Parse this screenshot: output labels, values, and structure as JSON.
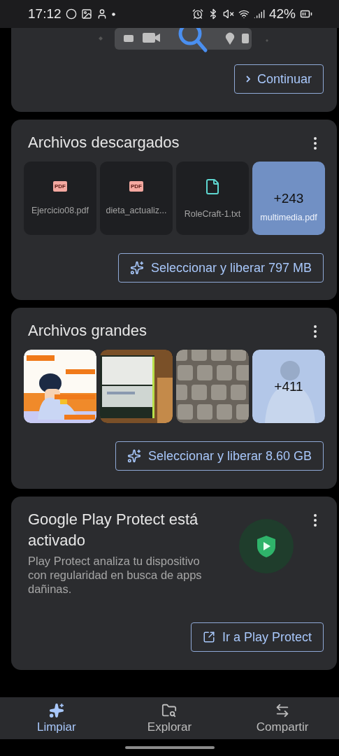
{
  "status_bar": {
    "time": "17:12",
    "battery": "42%"
  },
  "banner": {
    "button": "Continuar"
  },
  "downloads": {
    "title": "Archivos descargados",
    "files": [
      {
        "kind": "pdf",
        "badge": "PDF",
        "name": "Ejercicio08.pdf"
      },
      {
        "kind": "pdf",
        "badge": "PDF",
        "name": "dieta_actualiz..."
      },
      {
        "kind": "text",
        "name": "RoleCraft-1.txt"
      }
    ],
    "more": {
      "count": "+243",
      "name": "multimedia.pdf"
    },
    "button": "Seleccionar y liberar 797 MB"
  },
  "large_files": {
    "title": "Archivos grandes",
    "more": {
      "count": "+411"
    },
    "button": "Seleccionar y liberar 8.60 GB"
  },
  "protect": {
    "title": "Google Play Protect está activado",
    "description": "Play Protect analiza tu dispositivo con regularidad en busca de apps dañinas.",
    "button": "Ir a Play Protect"
  },
  "nav": [
    {
      "label": "Limpiar",
      "selected": true
    },
    {
      "label": "Explorar",
      "selected": false
    },
    {
      "label": "Compartir",
      "selected": false
    }
  ]
}
